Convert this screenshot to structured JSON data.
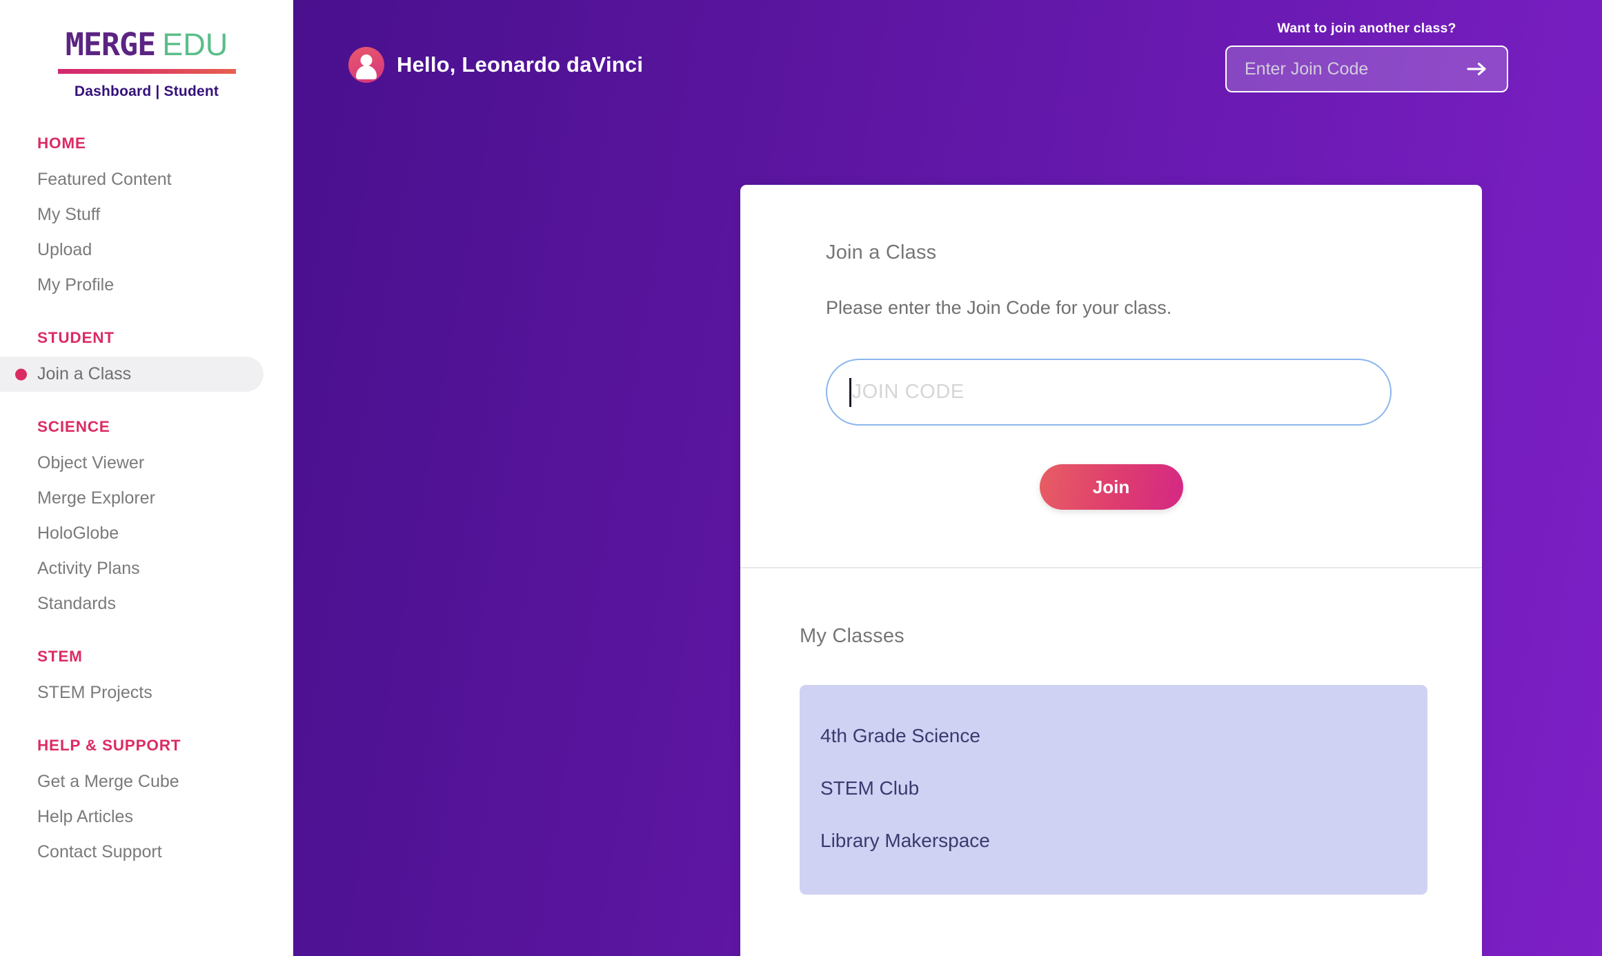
{
  "brand": {
    "logo_merge": "MERGE",
    "logo_edu": "EDU",
    "subtitle": "Dashboard | Student",
    "accent_pink": "#DB2B63",
    "accent_green": "#5BBE8A",
    "logo_purple": "#5B2482",
    "bg_purple_left": "#49108E",
    "bg_purple_right": "#7D20C6"
  },
  "sidebar": {
    "groups": [
      {
        "title": "HOME",
        "items": [
          {
            "label": "Featured Content",
            "active": false
          },
          {
            "label": "My Stuff",
            "active": false
          },
          {
            "label": "Upload",
            "active": false
          },
          {
            "label": "My Profile",
            "active": false
          }
        ]
      },
      {
        "title": "STUDENT",
        "items": [
          {
            "label": "Join a Class",
            "active": true
          }
        ]
      },
      {
        "title": "SCIENCE",
        "items": [
          {
            "label": "Object Viewer",
            "active": false
          },
          {
            "label": "Merge Explorer",
            "active": false
          },
          {
            "label": "HoloGlobe",
            "active": false
          },
          {
            "label": "Activity Plans",
            "active": false
          },
          {
            "label": "Standards",
            "active": false
          }
        ]
      },
      {
        "title": "STEM",
        "items": [
          {
            "label": "STEM Projects",
            "active": false
          }
        ]
      },
      {
        "title": "HELP & SUPPORT",
        "items": [
          {
            "label": "Get a Merge Cube",
            "active": false
          },
          {
            "label": "Help Articles",
            "active": false
          },
          {
            "label": "Contact Support",
            "active": false
          }
        ]
      }
    ]
  },
  "header": {
    "greeting": "Hello, Leonardo daVinci",
    "avatar_icon": "user-avatar-icon",
    "join_another_label": "Want to join another class?",
    "join_code_placeholder": "Enter Join Code",
    "join_code_value": "",
    "submit_icon": "arrow-right-icon"
  },
  "card": {
    "title": "Join a Class",
    "description": "Please enter the Join Code for your class.",
    "code_placeholder": "JOIN CODE",
    "code_value": "",
    "join_button": "Join"
  },
  "my_classes": {
    "title": "My Classes",
    "items": [
      {
        "name": "4th Grade Science"
      },
      {
        "name": "STEM Club"
      },
      {
        "name": "Library Makerspace"
      }
    ]
  }
}
